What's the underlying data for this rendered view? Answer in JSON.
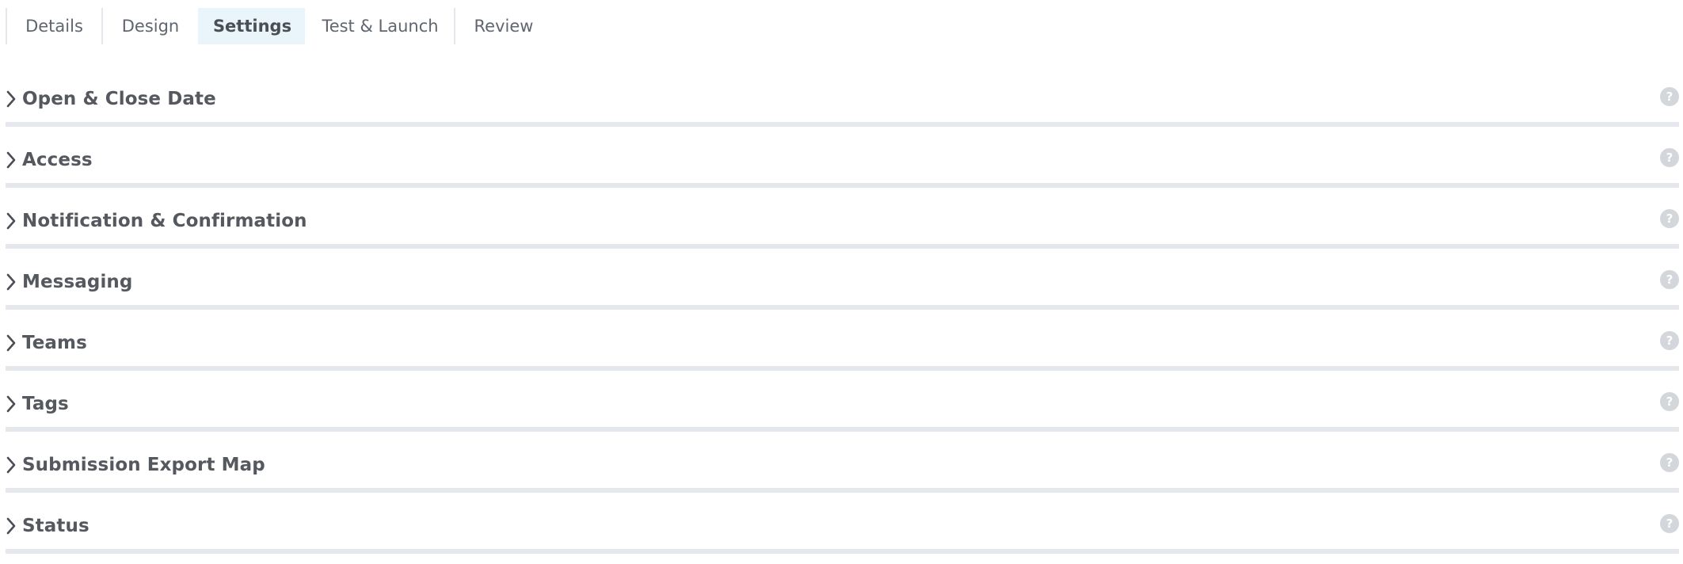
{
  "tabs": [
    {
      "label": "Details",
      "active": false
    },
    {
      "label": "Design",
      "active": false
    },
    {
      "label": "Settings",
      "active": true
    },
    {
      "label": "Test & Launch",
      "active": false
    },
    {
      "label": "Review",
      "active": false
    }
  ],
  "sections": [
    {
      "title": "Open & Close Date",
      "help": "?"
    },
    {
      "title": "Access",
      "help": "?"
    },
    {
      "title": "Notification & Confirmation",
      "help": "?"
    },
    {
      "title": "Messaging",
      "help": "?"
    },
    {
      "title": "Teams",
      "help": "?"
    },
    {
      "title": "Tags",
      "help": "?"
    },
    {
      "title": "Submission Export Map",
      "help": "?"
    },
    {
      "title": "Status",
      "help": "?"
    }
  ],
  "icons": {
    "expand": "chevron-right-icon",
    "help": "question-circle-icon"
  },
  "colors": {
    "active_tab_bg": "#e9f4fb",
    "divider": "#e4e7ec",
    "help_icon": "#d3d6da",
    "text": "#55595f"
  }
}
